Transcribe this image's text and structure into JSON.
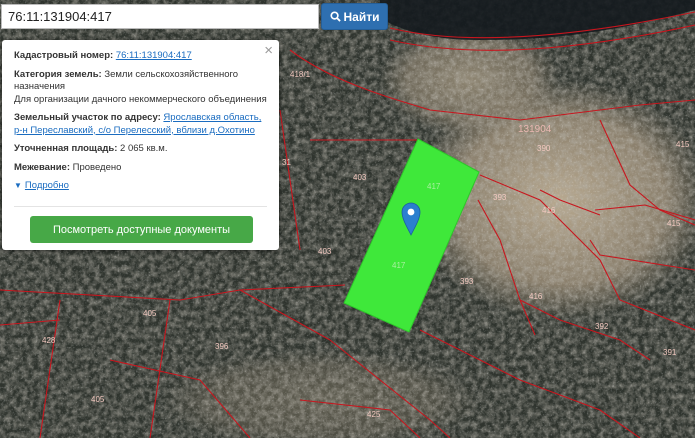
{
  "search": {
    "value": "76:11:131904:417",
    "button_label": "Найти"
  },
  "popup": {
    "cadastral_label": "Кадастровый номер:",
    "cadastral_value": "76:11:131904:417",
    "category_label": "Категория земель:",
    "category_value": "Земли сельскохозяйственного назначения",
    "usage_value": "Для организации дачного некоммерческого объединения",
    "address_label": "Земельный участок по адресу:",
    "address_value": "Ярославская область, р-н Переславский, с/о Перелесский, вблизи д.Охотино",
    "area_label": "Уточненная площадь:",
    "area_value": "2 065 кв.м.",
    "survey_label": "Межевание:",
    "survey_value": "Проведено",
    "more_label": "Подробно",
    "docs_button": "Посмотреть доступные документы"
  },
  "map_labels": {
    "block": "131904",
    "l418_1": "418/1",
    "l390": "390",
    "l415a": "415",
    "l415b": "415",
    "l417a": "417",
    "l417b": "417",
    "l403a": "403",
    "l403b": "403",
    "l393a": "393",
    "l393b": "393",
    "l416a": "416",
    "l416b": "416",
    "l392": "392",
    "l391": "391",
    "l405a": "405",
    "l405b": "405",
    "l396": "396",
    "l428": "428",
    "l425": "425",
    "l431": "31"
  },
  "colors": {
    "parcel_fill": "#3fe83a",
    "boundary": "#c8161e",
    "button_blue": "#2e6fb0",
    "button_green": "#47a847",
    "marker": "#2b7fcf"
  },
  "icons": {
    "search": "search-icon",
    "marker": "map-marker-icon",
    "close": "close-icon"
  }
}
